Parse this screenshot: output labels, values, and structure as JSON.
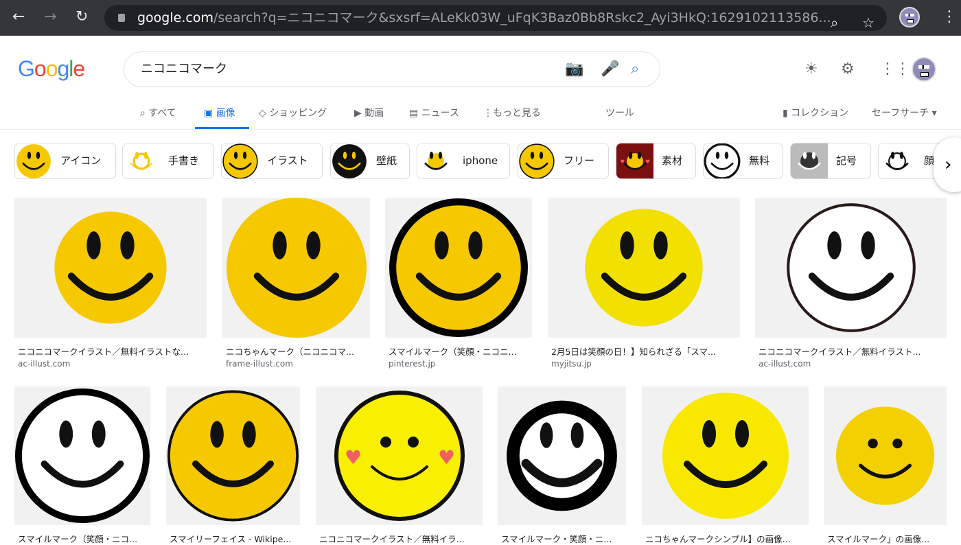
{
  "browser": {
    "url_host": "google.com",
    "url_path": "/search?q=ニコニコマーク&sxsrf=ALeKk03W_uFqK3Baz0Bb8Rskc2_Ayi3HkQ:1629102113586..."
  },
  "header": {
    "logo": "Google",
    "query": "ニコニコマーク"
  },
  "tabs": [
    {
      "label": "すべて",
      "icon": "search-icon"
    },
    {
      "label": "画像",
      "icon": "image-icon",
      "active": true
    },
    {
      "label": "ショッピング",
      "icon": "tag-icon"
    },
    {
      "label": "動画",
      "icon": "play-icon"
    },
    {
      "label": "ニュース",
      "icon": "news-icon"
    },
    {
      "label": "もっと見る",
      "icon": "more-icon"
    }
  ],
  "tools": "ツール",
  "collection": "コレクション",
  "safesearch": "セーフサーチ",
  "chips": [
    "アイコン",
    "手書き",
    "イラスト",
    "壁紙",
    "iphone",
    "フリー",
    "素材",
    "無料",
    "記号",
    "顔"
  ],
  "results_row1": [
    {
      "caption": "ニコニコマークイラスト／無料イラストな...",
      "source": "ac-illust.com"
    },
    {
      "caption": "ニコちゃんマーク（ニコニコマ...",
      "source": "frame-illust.com"
    },
    {
      "caption": "スマイルマーク（笑顔・ニコニ...",
      "source": "pinterest.jp"
    },
    {
      "caption": "2月5日は笑顔の日！】知られざる「スマ...",
      "source": "myjitsu.jp"
    },
    {
      "caption": "ニコニコマークイラスト／無料イラスト...",
      "source": "ac-illust.com"
    }
  ],
  "results_row2": [
    {
      "caption": "スマイルマーク（笑顔・ニコ..."
    },
    {
      "caption": "スマイリーフェイス - Wikipe..."
    },
    {
      "caption": "ニコニコマークイラスト／無料イラ..."
    },
    {
      "caption": "スマイルマーク・笑顔・ニ..."
    },
    {
      "caption": "ニコちゃんマークシンプル】の画像..."
    },
    {
      "caption": "スマイルマーク」の画像..."
    }
  ],
  "colors": {
    "accent": "#1a73e8",
    "smiley_yellow": "#f5c800"
  }
}
